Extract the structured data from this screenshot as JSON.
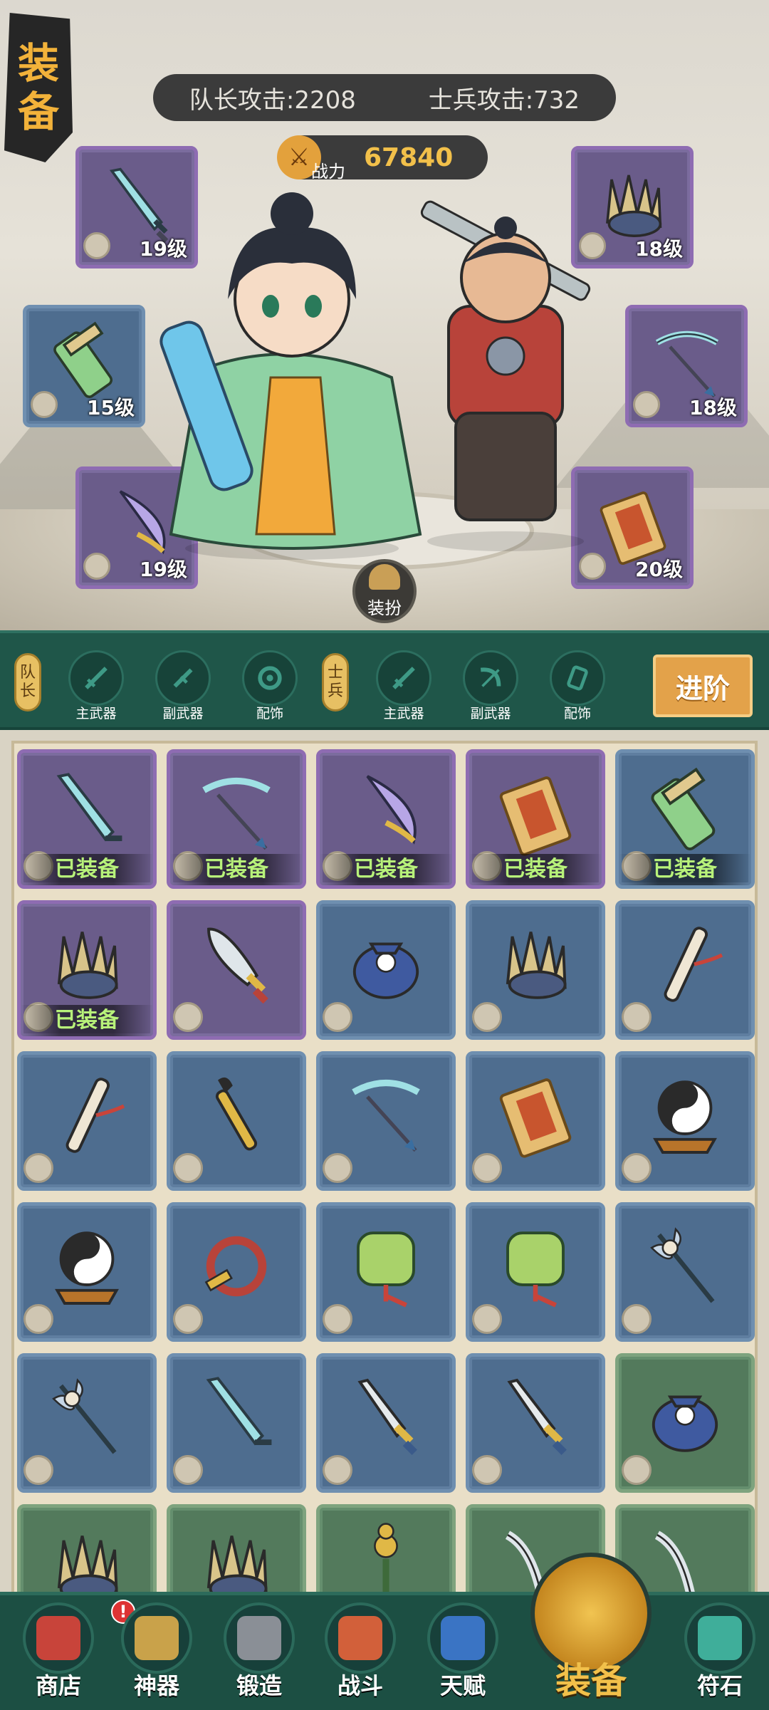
{
  "page_title": [
    "装",
    "备"
  ],
  "stats": {
    "captain_attack": "队长攻击:2208",
    "soldier_attack": "士兵攻击:732"
  },
  "power": {
    "label": "战力",
    "value": "67840"
  },
  "equipped_slots": {
    "captain_main": {
      "level": "19级",
      "icon": "jade-sword-icon"
    },
    "captain_sub": {
      "level": "15级",
      "icon": "bamboo-scroll-icon"
    },
    "captain_accessory": {
      "level": "19级",
      "icon": "crescent-blade-icon"
    },
    "soldier_main": {
      "level": "18级",
      "icon": "claw-gauntlet-icon"
    },
    "soldier_sub": {
      "level": "18级",
      "icon": "bow-icon"
    },
    "soldier_accessory": {
      "level": "20级",
      "icon": "talisman-icon"
    }
  },
  "dress_button": "装扮",
  "tabs": {
    "captain_tag": [
      "队",
      "长"
    ],
    "soldier_tag": [
      "士",
      "兵"
    ],
    "captain": [
      "主武器",
      "副武器",
      "配饰"
    ],
    "soldier": [
      "主武器",
      "副武器",
      "配饰"
    ],
    "advance": "进阶"
  },
  "inventory": {
    "equipped_label": "已装备",
    "items": [
      {
        "icon": "jade-sword-icon",
        "rarity": "purple",
        "equipped": true
      },
      {
        "icon": "bow-icon",
        "rarity": "purple",
        "equipped": true
      },
      {
        "icon": "crescent-blade-icon",
        "rarity": "purple",
        "equipped": true
      },
      {
        "icon": "talisman-icon",
        "rarity": "purple",
        "equipped": true
      },
      {
        "icon": "bamboo-scroll-icon",
        "rarity": "blue",
        "equipped": true
      },
      {
        "icon": "claw-gauntlet-icon",
        "rarity": "purple",
        "equipped": true
      },
      {
        "icon": "broadsword-icon",
        "rarity": "purple",
        "equipped": false
      },
      {
        "icon": "yinyang-pouch-icon",
        "rarity": "blue",
        "equipped": false
      },
      {
        "icon": "claw-gauntlet-icon",
        "rarity": "blue",
        "equipped": false
      },
      {
        "icon": "flute-icon",
        "rarity": "blue",
        "equipped": false
      },
      {
        "icon": "flute-icon",
        "rarity": "blue",
        "equipped": false
      },
      {
        "icon": "brush-icon",
        "rarity": "blue",
        "equipped": false
      },
      {
        "icon": "bow-icon",
        "rarity": "blue",
        "equipped": false
      },
      {
        "icon": "talisman-icon",
        "rarity": "blue",
        "equipped": false
      },
      {
        "icon": "yinyang-orb-icon",
        "rarity": "blue",
        "equipped": false
      },
      {
        "icon": "yinyang-orb-icon",
        "rarity": "blue",
        "equipped": false
      },
      {
        "icon": "whip-icon",
        "rarity": "blue",
        "equipped": false
      },
      {
        "icon": "jade-pendant-icon",
        "rarity": "blue",
        "equipped": false
      },
      {
        "icon": "jade-pendant-icon",
        "rarity": "blue",
        "equipped": false
      },
      {
        "icon": "skull-halberd-icon",
        "rarity": "blue",
        "equipped": false
      },
      {
        "icon": "skull-halberd-icon",
        "rarity": "blue",
        "equipped": false
      },
      {
        "icon": "jade-sword-icon",
        "rarity": "blue",
        "equipped": false
      },
      {
        "icon": "dagger-icon",
        "rarity": "blue",
        "equipped": false
      },
      {
        "icon": "dagger-icon",
        "rarity": "blue",
        "equipped": false
      },
      {
        "icon": "yinyang-pouch-icon",
        "rarity": "green",
        "equipped": false
      },
      {
        "icon": "claw-gauntlet-icon",
        "rarity": "green",
        "equipped": false
      },
      {
        "icon": "claw-gauntlet-icon",
        "rarity": "green",
        "equipped": false
      },
      {
        "icon": "gourd-staff-icon",
        "rarity": "green",
        "equipped": false
      },
      {
        "icon": "curved-blade-icon",
        "rarity": "green",
        "equipped": false
      },
      {
        "icon": "curved-blade-icon",
        "rarity": "green",
        "equipped": false
      }
    ]
  },
  "bottom_nav": [
    {
      "label": "商店",
      "icon": "shop-icon",
      "color": "#c8443a",
      "alert": "!"
    },
    {
      "label": "神器",
      "icon": "artifact-icon",
      "color": "#c9a24a"
    },
    {
      "label": "锻造",
      "icon": "anvil-icon",
      "color": "#8a8f96"
    },
    {
      "label": "战斗",
      "icon": "battle-icon",
      "color": "#d2603a"
    },
    {
      "label": "天赋",
      "icon": "talent-icon",
      "color": "#3a74c4"
    },
    {
      "label": "符石",
      "icon": "rune-icon",
      "color": "#3fae9a"
    }
  ],
  "bottom_nav_main": {
    "label": "装备",
    "icon": "helmet-icon"
  },
  "colors": {
    "accent": "#e3a24a",
    "equipped_text": "#b8f27a",
    "power_value": "#f2c04a"
  }
}
